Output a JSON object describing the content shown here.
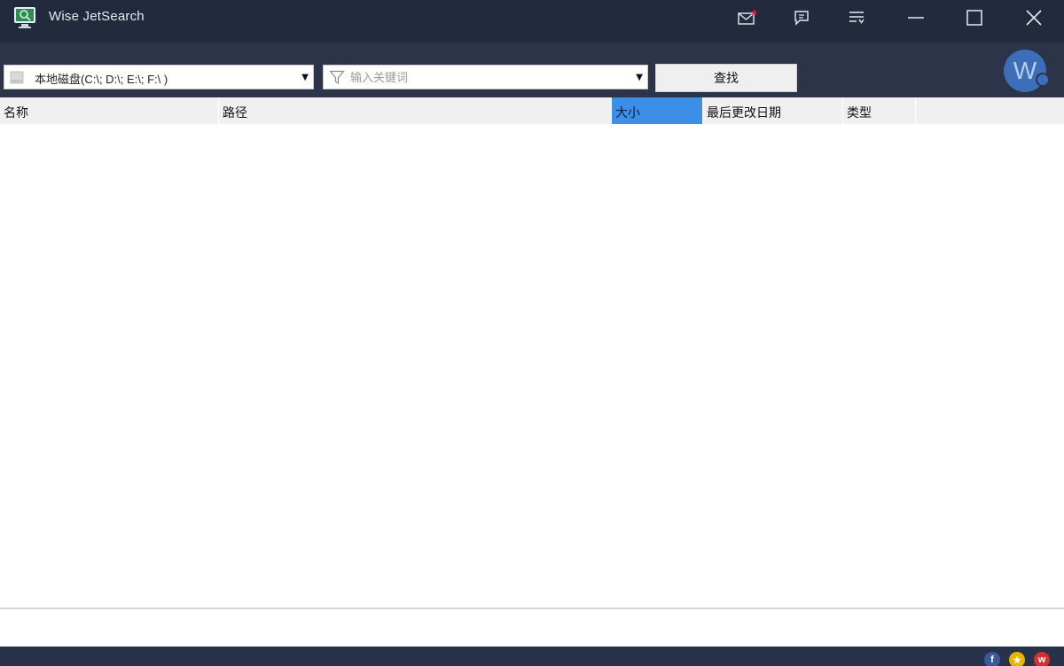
{
  "window": {
    "title": "Wise JetSearch",
    "controls": [
      "mail-icon",
      "feedback-icon",
      "menu-icon",
      "minimize-icon",
      "maximize-icon",
      "close-icon"
    ]
  },
  "toolbar": {
    "drive_select": {
      "value": "本地磁盘(C:\\; D:\\; E:\\; F:\\ )"
    },
    "keyword": {
      "placeholder": "输入关键词",
      "value": ""
    },
    "search_label": "查找",
    "avatar_letter": "W"
  },
  "results": {
    "columns": [
      "名称",
      "路径",
      "大小",
      "最后更改日期",
      "类型",
      ""
    ],
    "active_column": "大小",
    "rows": []
  },
  "colors": {
    "titlebar": "#222b3d",
    "toolbar": "#2b3449",
    "accent": "#3d8ee6",
    "notification": "#e0202a"
  },
  "footer": {
    "icons": [
      "facebook-icon",
      "star-icon",
      "weibo-icon"
    ]
  }
}
